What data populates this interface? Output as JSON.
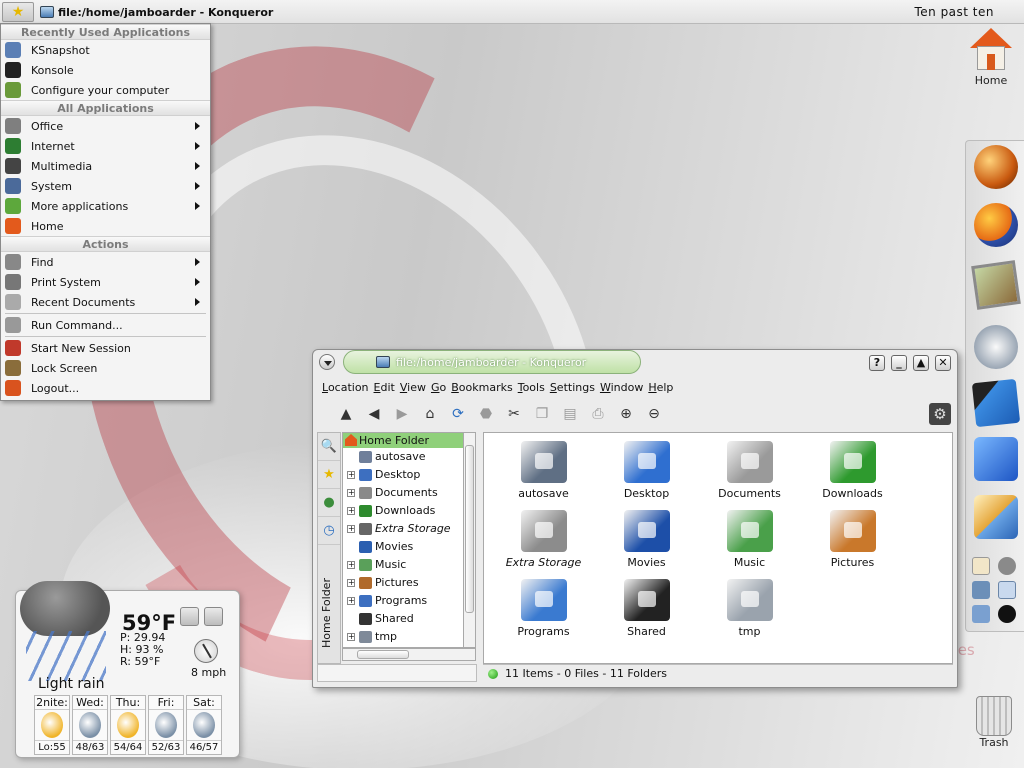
{
  "top_panel": {
    "task_title": "file:/home/jamboarder - Konqueror",
    "clock": "Ten past ten"
  },
  "kmenu": {
    "header_recent": "Recently Used Applications",
    "recent": [
      {
        "label": "KSnapshot",
        "icon": "camera-icon",
        "color": "#5b7fb5"
      },
      {
        "label": "Konsole",
        "icon": "terminal-icon",
        "color": "#222222"
      },
      {
        "label": "Configure your computer",
        "icon": "control-center-icon",
        "color": "#6a9a3a"
      }
    ],
    "header_all": "All Applications",
    "all": [
      {
        "label": "Office",
        "icon": "office-icon",
        "color": "#7f7f7f",
        "submenu": true
      },
      {
        "label": "Internet",
        "icon": "globe-icon",
        "color": "#2d7d32",
        "submenu": true
      },
      {
        "label": "Multimedia",
        "icon": "multimedia-icon",
        "color": "#444444",
        "submenu": true
      },
      {
        "label": "System",
        "icon": "computer-icon",
        "color": "#4b6a9a",
        "submenu": true
      },
      {
        "label": "More applications",
        "icon": "more-apps-icon",
        "color": "#5da83c",
        "submenu": true
      },
      {
        "label": "Home",
        "icon": "home-icon",
        "color": "#e35a1c",
        "submenu": false
      }
    ],
    "header_actions": "Actions",
    "actions": [
      {
        "label": "Find",
        "icon": "find-icon",
        "color": "#888888",
        "submenu": true
      },
      {
        "label": "Print System",
        "icon": "printer-icon",
        "color": "#777777",
        "submenu": true
      },
      {
        "label": "Recent Documents",
        "icon": "document-icon",
        "color": "#aaaaaa",
        "submenu": true
      },
      {
        "label": "Run Command...",
        "icon": "gear-icon",
        "color": "#999999",
        "submenu": false
      },
      {
        "label": "Start New Session",
        "icon": "rocket-icon",
        "color": "#c0392b",
        "submenu": false
      },
      {
        "label": "Lock Screen",
        "icon": "lock-icon",
        "color": "#8a6d3b",
        "submenu": false
      },
      {
        "label": "Logout...",
        "icon": "logout-icon",
        "color": "#d9531e",
        "submenu": false
      }
    ]
  },
  "desktop": {
    "home_label": "Home",
    "trash_label": "Trash",
    "tray_text": "gles"
  },
  "weather": {
    "temp": "59°F",
    "pressure": "P: 29.94",
    "humidity": "H: 93 %",
    "real": "R: 59°F",
    "wind": "8 mph",
    "condition": "Light rain",
    "forecast": [
      {
        "day": "2nite:",
        "temps": "Lo:55",
        "icon": "partly-sunny-icon",
        "color": "#f0b429"
      },
      {
        "day": "Wed:",
        "temps": "48/63",
        "icon": "rain-icon",
        "color": "#7a8fa6"
      },
      {
        "day": "Thu:",
        "temps": "54/64",
        "icon": "partly-sunny-icon",
        "color": "#f0b429"
      },
      {
        "day": "Fri:",
        "temps": "52/63",
        "icon": "rain-icon",
        "color": "#7a8fa6"
      },
      {
        "day": "Sat:",
        "temps": "46/57",
        "icon": "rain-icon",
        "color": "#7a8fa6"
      }
    ]
  },
  "konqueror": {
    "title": "file:/home/jamboarder - Konqueror",
    "menu": [
      "Location",
      "Edit",
      "View",
      "Go",
      "Bookmarks",
      "Tools",
      "Settings",
      "Window",
      "Help"
    ],
    "window_buttons": [
      "?",
      "_",
      "▲",
      "✕"
    ],
    "sidebar_tab_label": "Home Folder",
    "tree_root": "Home Folder",
    "tree": [
      {
        "label": "autosave",
        "expand": "",
        "color": "#6f7f9a",
        "italic": false
      },
      {
        "label": "Desktop",
        "expand": "+",
        "color": "#3d6fc0",
        "italic": false
      },
      {
        "label": "Documents",
        "expand": "+",
        "color": "#8a8a8a",
        "italic": false
      },
      {
        "label": "Downloads",
        "expand": "+",
        "color": "#2e8b2e",
        "italic": false
      },
      {
        "label": "Extra Storage",
        "expand": "+",
        "color": "#666666",
        "italic": true
      },
      {
        "label": "Movies",
        "expand": "",
        "color": "#2b5fb0",
        "italic": false
      },
      {
        "label": "Music",
        "expand": "+",
        "color": "#5aa05a",
        "italic": false
      },
      {
        "label": "Pictures",
        "expand": "+",
        "color": "#b06a2b",
        "italic": false
      },
      {
        "label": "Programs",
        "expand": "+",
        "color": "#3d6fc0",
        "italic": false
      },
      {
        "label": "Shared",
        "expand": "",
        "color": "#333333",
        "italic": false
      },
      {
        "label": "tmp",
        "expand": "+",
        "color": "#7f8a99",
        "italic": false
      }
    ],
    "files": [
      {
        "label": "autosave",
        "color": "#5f6f84",
        "italic": false
      },
      {
        "label": "Desktop",
        "color": "#2f6fd0",
        "italic": false
      },
      {
        "label": "Documents",
        "color": "#9a9a9a",
        "italic": false
      },
      {
        "label": "Downloads",
        "color": "#2e9a2e",
        "italic": false
      },
      {
        "label": "Extra Storage",
        "color": "#8c8c8c",
        "italic": true
      },
      {
        "label": "Movies",
        "color": "#1d4fa8",
        "italic": false
      },
      {
        "label": "Music",
        "color": "#4aa04a",
        "italic": false
      },
      {
        "label": "Pictures",
        "color": "#c9782b",
        "italic": false
      },
      {
        "label": "Programs",
        "color": "#3a7ad0",
        "italic": false
      },
      {
        "label": "Shared",
        "color": "#222222",
        "italic": false
      },
      {
        "label": "tmp",
        "color": "#9aa3ad",
        "italic": false
      }
    ],
    "status": "11 Items - 0 Files - 11 Folders"
  }
}
